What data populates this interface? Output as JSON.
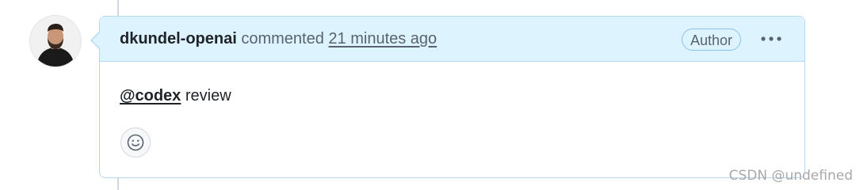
{
  "comment": {
    "author": "dkundel-openai",
    "action": "commented",
    "timestamp": "21 minutes ago",
    "badge": "Author",
    "mention": "@codex",
    "body_text": " review"
  },
  "icons": {
    "more": "kebab-horizontal-icon",
    "reaction": "smiley-icon"
  },
  "colors": {
    "header_bg": "#ddf4ff",
    "border": "#b6d8f5",
    "text": "#1f2328",
    "muted": "#59636e"
  },
  "watermark": "CSDN @undefined"
}
